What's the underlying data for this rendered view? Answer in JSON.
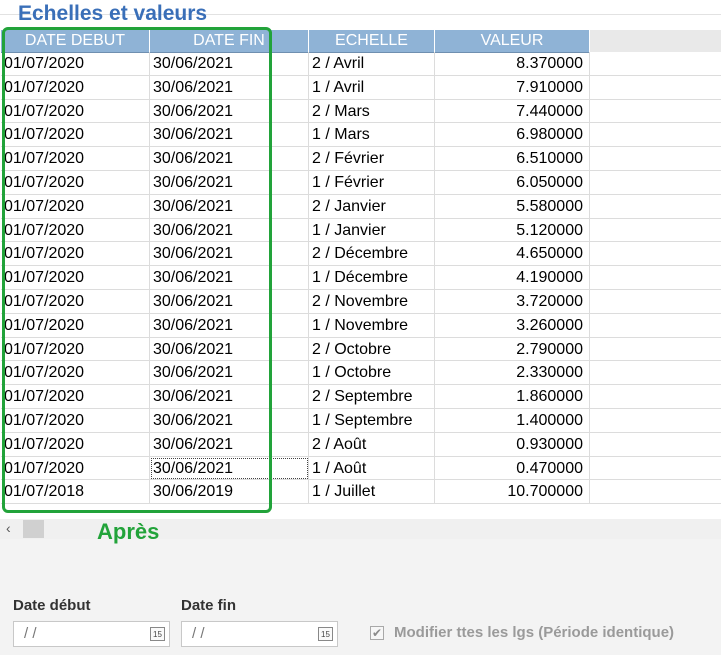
{
  "section_title": "Echelles et valeurs",
  "table": {
    "headers": [
      "DATE DEBUT",
      "DATE FIN",
      "ECHELLE",
      "VALEUR"
    ],
    "rows": [
      [
        "01/07/2020",
        "30/06/2021",
        "2 / Avril",
        "8.370000"
      ],
      [
        "01/07/2020",
        "30/06/2021",
        "1 / Avril",
        "7.910000"
      ],
      [
        "01/07/2020",
        "30/06/2021",
        "2 / Mars",
        "7.440000"
      ],
      [
        "01/07/2020",
        "30/06/2021",
        "1 / Mars",
        "6.980000"
      ],
      [
        "01/07/2020",
        "30/06/2021",
        "2 / Février",
        "6.510000"
      ],
      [
        "01/07/2020",
        "30/06/2021",
        "1 / Février",
        "6.050000"
      ],
      [
        "01/07/2020",
        "30/06/2021",
        "2 / Janvier",
        "5.580000"
      ],
      [
        "01/07/2020",
        "30/06/2021",
        "1 / Janvier",
        "5.120000"
      ],
      [
        "01/07/2020",
        "30/06/2021",
        "2 / Décembre",
        "4.650000"
      ],
      [
        "01/07/2020",
        "30/06/2021",
        "1 / Décembre",
        "4.190000"
      ],
      [
        "01/07/2020",
        "30/06/2021",
        "2 / Novembre",
        "3.720000"
      ],
      [
        "01/07/2020",
        "30/06/2021",
        "1 / Novembre",
        "3.260000"
      ],
      [
        "01/07/2020",
        "30/06/2021",
        "2 / Octobre",
        "2.790000"
      ],
      [
        "01/07/2020",
        "30/06/2021",
        "1 / Octobre",
        "2.330000"
      ],
      [
        "01/07/2020",
        "30/06/2021",
        "2 / Septembre",
        "1.860000"
      ],
      [
        "01/07/2020",
        "30/06/2021",
        "1 / Septembre",
        "1.400000"
      ],
      [
        "01/07/2020",
        "30/06/2021",
        "2 / Août",
        "0.930000"
      ],
      [
        "01/07/2020",
        "30/06/2021",
        "1 / Août",
        "0.470000"
      ],
      [
        "01/07/2018",
        "30/06/2019",
        "1 / Juillet",
        "10.700000"
      ]
    ],
    "focused_row": 17,
    "focused_col": 1
  },
  "annotation": {
    "label": "Après",
    "color": "#22a33a"
  },
  "scrollbar": {
    "left_arrow": "‹"
  },
  "form": {
    "date_debut_label": "Date début",
    "date_debut_value": " /  /",
    "date_fin_label": "Date fin",
    "date_fin_value": " /  /",
    "calendar_glyph": "15",
    "modify_all_label": "Modifier ttes les lgs (Période identique)",
    "modify_all_checked": true,
    "check_glyph": "✔"
  },
  "colors": {
    "title": "#3a6fb8",
    "header_bg": "#8fb3d6",
    "highlight": "#22a33a"
  }
}
